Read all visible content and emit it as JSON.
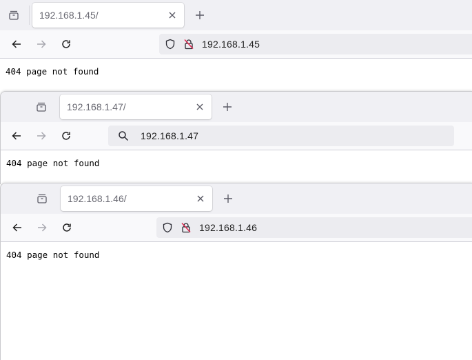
{
  "windows": [
    {
      "tab_title": "192.168.1.45/",
      "url": "192.168.1.45",
      "url_mode": "insecure",
      "page_text": "404 page not found"
    },
    {
      "tab_title": "192.168.1.47/",
      "url": "192.168.1.47",
      "url_mode": "search",
      "page_text": "404 page not found"
    },
    {
      "tab_title": "192.168.1.46/",
      "url": "192.168.1.46",
      "url_mode": "insecure",
      "page_text": "404 page not found"
    }
  ],
  "icons": {
    "tab_list": "tab-list-icon",
    "new_tab": "plus-icon",
    "tab_close": "close-icon",
    "back": "back-arrow-icon",
    "forward": "forward-arrow-icon",
    "reload": "reload-icon",
    "shield": "shield-icon",
    "insecure_lock": "insecure-lock-icon",
    "search": "search-icon"
  },
  "colors": {
    "tabstrip_bg": "#f0f0f4",
    "navbar_bg": "#f9f9fb",
    "urlbar_bg": "#ececf0",
    "insecure_slash": "#e22850"
  }
}
